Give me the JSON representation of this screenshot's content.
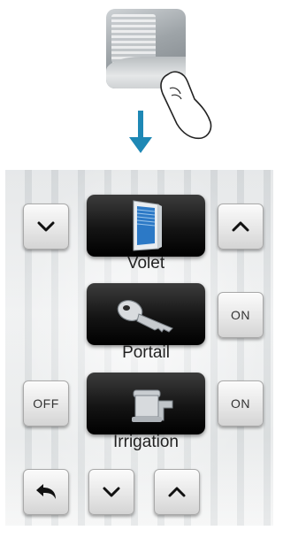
{
  "header": {
    "thumbnail_icon": "bedroom-blinds-thumbnail",
    "finger_icon": "finger-tap-icon",
    "arrow_icon": "arrow-down-icon",
    "arrow_color": "#1e88b5"
  },
  "devices": [
    {
      "label": "Volet",
      "icon": "window-shutter-icon",
      "left_button": "chevron-down",
      "right_button": "chevron-up"
    },
    {
      "label": "Portail",
      "icon": "key-icon",
      "right_button_label": "ON"
    },
    {
      "label": "Irrigation",
      "icon": "faucet-icon",
      "left_button_label": "OFF",
      "right_button_label": "ON"
    }
  ],
  "footer": {
    "back_icon": "back-arrow-icon",
    "down_icon": "chevron-down-icon",
    "up_icon": "chevron-up-icon"
  }
}
